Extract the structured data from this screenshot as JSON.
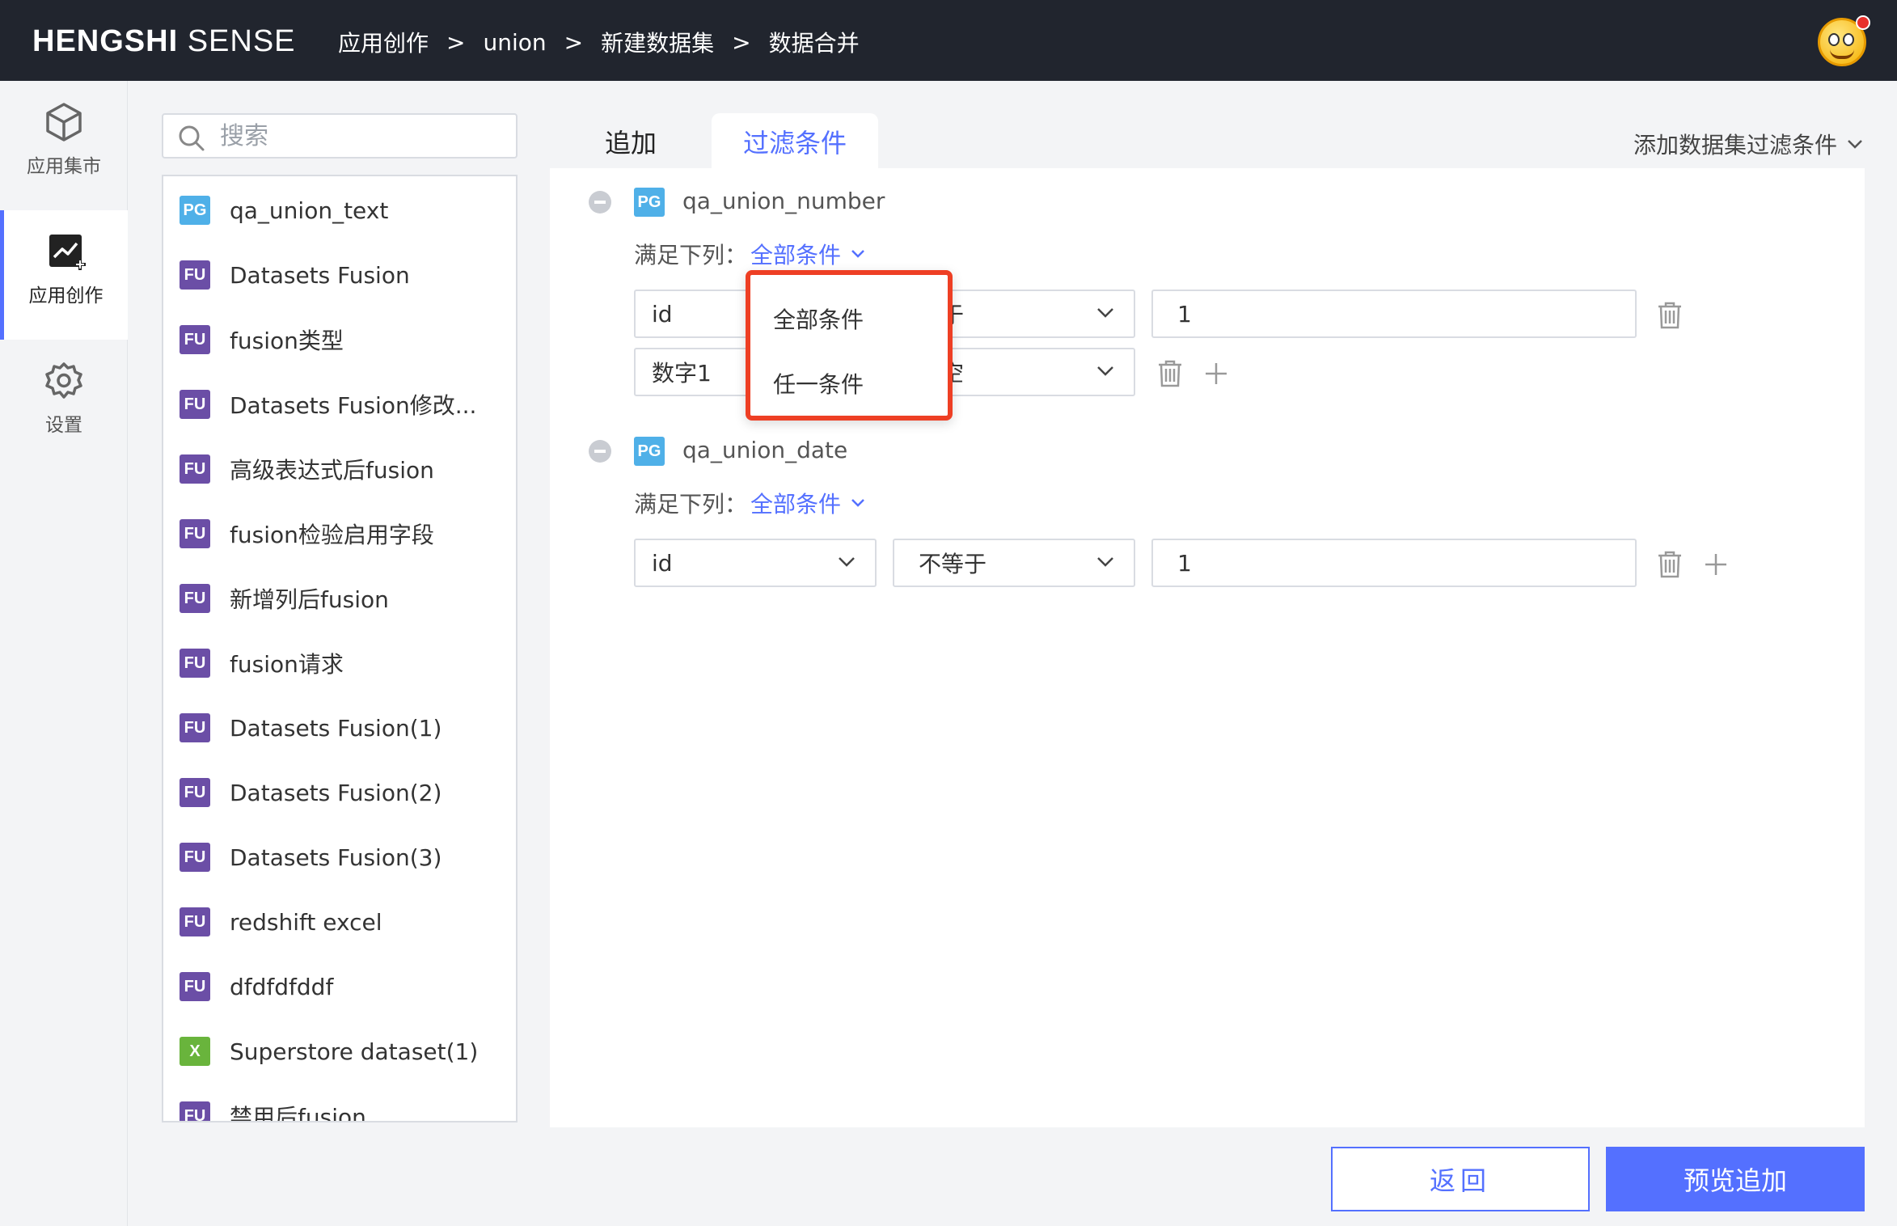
{
  "header": {
    "brand_bold": "HENGSHI",
    "brand_light": "SENSE",
    "breadcrumb": [
      "应用创作",
      "union",
      "新建数据集",
      "数据合并"
    ],
    "separator": ">"
  },
  "nav": {
    "items": [
      {
        "label": "应用集市",
        "icon": "cube-icon"
      },
      {
        "label": "应用创作",
        "icon": "chart-create-icon"
      },
      {
        "label": "设置",
        "icon": "gear-icon"
      }
    ]
  },
  "search": {
    "placeholder": "搜索"
  },
  "datasets": [
    {
      "type": "PG",
      "name": "qa_union_text"
    },
    {
      "type": "FU",
      "name": "Datasets Fusion"
    },
    {
      "type": "FU",
      "name": "fusion类型"
    },
    {
      "type": "FU",
      "name": "Datasets Fusion修改..."
    },
    {
      "type": "FU",
      "name": "高级表达式后fusion"
    },
    {
      "type": "FU",
      "name": "fusion检验启用字段"
    },
    {
      "type": "FU",
      "name": "新增列后fusion"
    },
    {
      "type": "FU",
      "name": "fusion请求"
    },
    {
      "type": "FU",
      "name": "Datasets Fusion(1)"
    },
    {
      "type": "FU",
      "name": "Datasets Fusion(2)"
    },
    {
      "type": "FU",
      "name": "Datasets Fusion(3)"
    },
    {
      "type": "FU",
      "name": "redshift excel"
    },
    {
      "type": "FU",
      "name": "dfdfdfddf"
    },
    {
      "type": "X",
      "name": "Superstore dataset(1)"
    },
    {
      "type": "FU",
      "name": "禁用后fusion"
    }
  ],
  "tabs": {
    "add": "追加",
    "filter": "过滤条件"
  },
  "add_filter_label": "添加数据集过滤条件",
  "groups": [
    {
      "badge": "PG",
      "name": "qa_union_number",
      "meet_label": "满足下列：",
      "meet_value": "全部条件",
      "conditions": [
        {
          "field": "id",
          "op": "等于",
          "value": "1"
        },
        {
          "field": "数字1",
          "op": "为空",
          "value": ""
        }
      ]
    },
    {
      "badge": "PG",
      "name": "qa_union_date",
      "meet_label": "满足下列：",
      "meet_value": "全部条件",
      "conditions": [
        {
          "field": "id",
          "op": "不等于",
          "value": "1"
        }
      ]
    }
  ],
  "dropdown": {
    "options": [
      "全部条件",
      "任一条件"
    ]
  },
  "buttons": {
    "back": "返回",
    "preview": "预览追加"
  },
  "colors": {
    "accent": "#5470ff",
    "topbar": "#21252e",
    "highlight": "#ee3f24",
    "pg": "#4fb0e8",
    "fu": "#6b4ea6",
    "x": "#69b43c"
  }
}
